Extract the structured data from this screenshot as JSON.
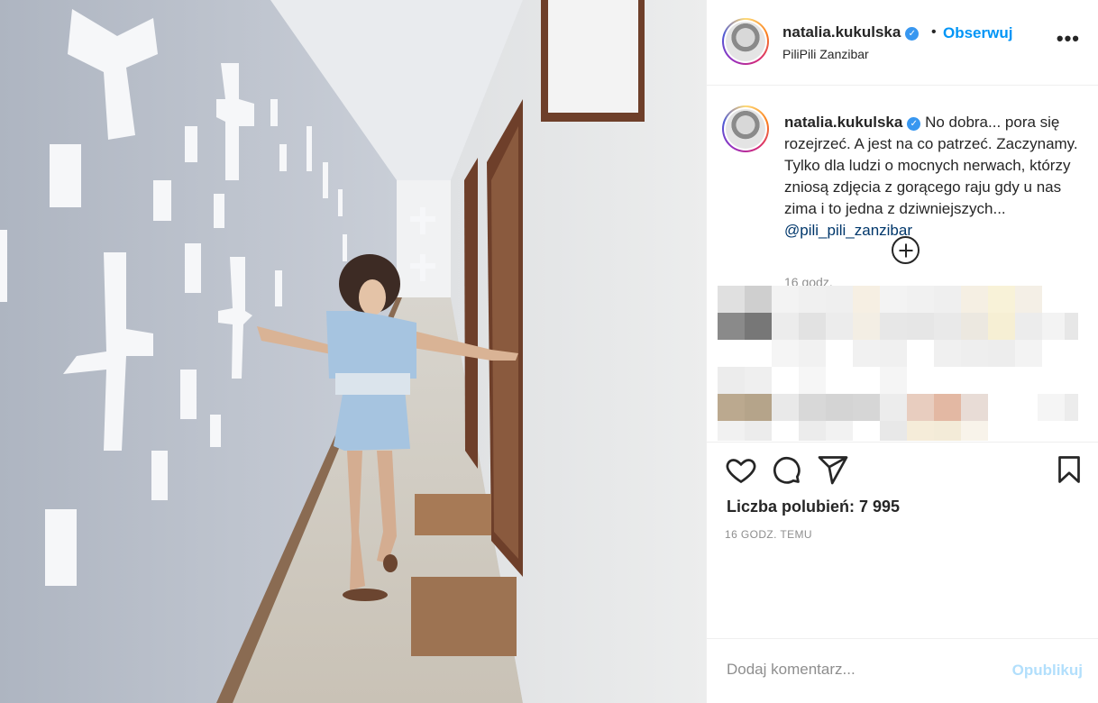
{
  "post": {
    "username": "natalia.kukulska",
    "verified_mark": "✓",
    "separator": "•",
    "follow_label": "Obserwuj",
    "more_label": "•••",
    "location": "PiliPili Zanzibar",
    "caption_user": "natalia.kukulska",
    "caption_text": "No dobra... pora się rozejrzeć. A jest na co patrzeć. Zaczynamy. Tylko dla ludzi o mocnych nerwach, którzy zniosą zdjęcia z gorącego raju gdy u nas zima i to jedna z dziwniejszych...",
    "caption_mention": "@pili_pili_zanzibar",
    "caption_time": "16 godz.",
    "likes_label": "Liczba polubień: 7 995",
    "time_ago": "16 GODZ. TEMU",
    "comment_placeholder": "Dodaj komentarz...",
    "publish_label": "Opublikuj"
  },
  "icons": {
    "like": "heart-icon",
    "comment": "comment-icon",
    "share": "share-icon",
    "save": "bookmark-icon",
    "load_more": "plus-circle-icon",
    "verified": "verified-badge-icon"
  },
  "colors": {
    "accent": "#0095f6",
    "verified": "#3897f0",
    "mention": "#00376b",
    "muted": "#8e8e8e",
    "publish_disabled": "#b2dffc"
  }
}
